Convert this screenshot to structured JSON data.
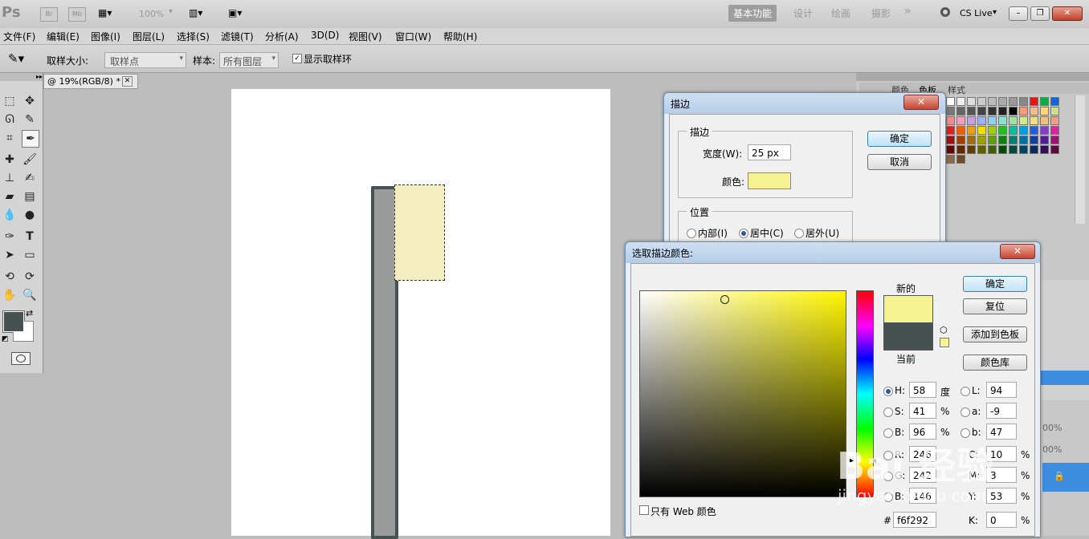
{
  "app": {
    "logo": "Ps",
    "bridge": "Br",
    "mini_bridge": "Mb",
    "zoom": "100%",
    "workspaces": [
      "基本功能",
      "设计",
      "绘画",
      "摄影"
    ],
    "more": "»",
    "cslive": "CS Live"
  },
  "menu": [
    "文件(F)",
    "编辑(E)",
    "图像(I)",
    "图层(L)",
    "选择(S)",
    "滤镜(T)",
    "分析(A)",
    "3D(D)",
    "视图(V)",
    "窗口(W)",
    "帮助(H)"
  ],
  "options": {
    "sample_size_label": "取样大小:",
    "sample_size_value": "取样点",
    "sample_label": "样本:",
    "sample_value": "所有图层",
    "show_ring_label": "显示取样环"
  },
  "document": {
    "tab_title": "@ 19%(RGB/8) *"
  },
  "panels": {
    "swatch_tabs": [
      "颜色",
      "色板",
      "样式"
    ],
    "opacity_1": "00%",
    "opacity_2": "00%"
  },
  "stroke_dialog": {
    "title": "描边",
    "group_stroke": "描边",
    "width_label": "宽度(W):",
    "width_value": "25 px",
    "color_label": "颜色:",
    "color_value": "#f6f292",
    "ok": "确定",
    "cancel": "取消",
    "group_position": "位置",
    "pos_inside": "内部(I)",
    "pos_center": "居中(C)",
    "pos_outside": "居外(U)"
  },
  "picker_dialog": {
    "title": "选取描边颜色:",
    "new_label": "新的",
    "current_label": "当前",
    "new_color": "#f6f292",
    "current_color": "#465152",
    "ok": "确定",
    "reset": "复位",
    "add_swatch": "添加到色板",
    "color_library": "颜色库",
    "web_only": "只有 Web 颜色",
    "H": {
      "label": "H:",
      "value": "58",
      "unit": "度"
    },
    "S": {
      "label": "S:",
      "value": "41",
      "unit": "%"
    },
    "B": {
      "label": "B:",
      "value": "96",
      "unit": "%"
    },
    "R": {
      "label": "R:",
      "value": "246"
    },
    "G": {
      "label": "G:",
      "value": "242"
    },
    "Bv": {
      "label": "B:",
      "value": "146"
    },
    "L": {
      "label": "L:",
      "value": "94"
    },
    "a": {
      "label": "a:",
      "value": "-9"
    },
    "b": {
      "label": "b:",
      "value": "47"
    },
    "C": {
      "label": "C:",
      "value": "10",
      "unit": "%"
    },
    "M": {
      "label": "M:",
      "value": "3",
      "unit": "%"
    },
    "Y": {
      "label": "Y:",
      "value": "53",
      "unit": "%"
    },
    "K": {
      "label": "K:",
      "value": "0",
      "unit": "%"
    },
    "hex_label": "#",
    "hex": "f6f292"
  },
  "watermark": {
    "main": "Bai 经验",
    "sub": "jingyan.baidu.com"
  }
}
